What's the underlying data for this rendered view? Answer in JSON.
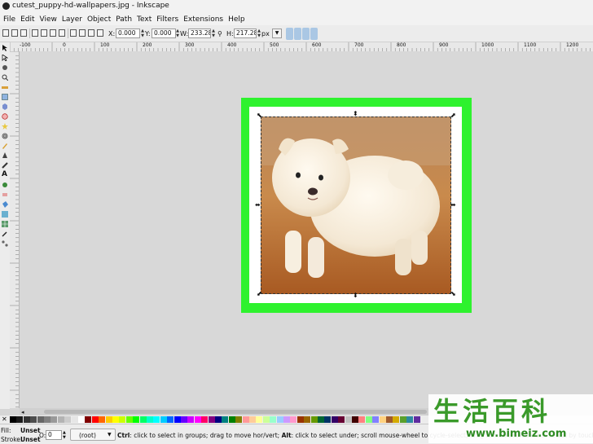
{
  "window": {
    "title": "cutest_puppy-hd-wallpapers.jpg - Inkscape"
  },
  "menu": [
    "File",
    "Edit",
    "View",
    "Layer",
    "Object",
    "Path",
    "Text",
    "Filters",
    "Extensions",
    "Help"
  ],
  "toolbar": {
    "x_label": "X:",
    "x_value": "0.000",
    "y_label": "Y:",
    "y_value": "0.000",
    "w_label": "W:",
    "w_value": "233.280",
    "h_label": "H:",
    "h_value": "217.280",
    "unit": "px"
  },
  "ruler": {
    "top_labels": [
      "-100",
      "0",
      "100",
      "200",
      "300",
      "400",
      "500",
      "600",
      "700",
      "800",
      "900",
      "1000",
      "1100",
      "1200"
    ]
  },
  "status": {
    "fill_label": "Fill:",
    "fill_value": "Unset",
    "stroke_label": "Stroke:",
    "stroke_value": "Unset",
    "opacity_label": "O:",
    "opacity_value": "0",
    "layer_value": "(root)",
    "hint_ctrl": "Ctrl",
    "hint_text1": ": click to select in groups; drag to move hor/vert; ",
    "hint_alt": "Alt",
    "hint_text2": ": click to select under; scroll mouse-wheel to cycle-select; drag to move selected or select by touch"
  },
  "watermark": {
    "chars": "生活百科",
    "url": "www.bimeiz.com"
  },
  "colors": {
    "page_border": "#2ef22e",
    "app_bg": "#d6d6d6",
    "highlight": "#aac7e4"
  },
  "palette_colors": [
    "#000000",
    "#1a1a1a",
    "#333333",
    "#4d4d4d",
    "#666666",
    "#808080",
    "#999999",
    "#b3b3b3",
    "#cccccc",
    "#e6e6e6",
    "#ffffff",
    "#800000",
    "#ff0000",
    "#ff6600",
    "#ffcc00",
    "#ffff00",
    "#ccff00",
    "#66ff00",
    "#00ff00",
    "#00ff66",
    "#00ffcc",
    "#00ffff",
    "#00ccff",
    "#0066ff",
    "#0000ff",
    "#6600ff",
    "#cc00ff",
    "#ff00ff",
    "#ff0066",
    "#800080",
    "#000080",
    "#008080",
    "#008000",
    "#808000",
    "#ff9999",
    "#ffcc99",
    "#ffff99",
    "#ccff99",
    "#99ffcc",
    "#99ccff",
    "#cc99ff",
    "#ff99cc",
    "#993300",
    "#996600",
    "#669900",
    "#006633",
    "#003366",
    "#330066",
    "#660033",
    "#c0c0c0",
    "#400000",
    "#ff8080",
    "#80ff80",
    "#8080ff",
    "#ffd280",
    "#a05a2c",
    "#d4aa00",
    "#5aa02c",
    "#2c89a0",
    "#5f2ca0"
  ]
}
